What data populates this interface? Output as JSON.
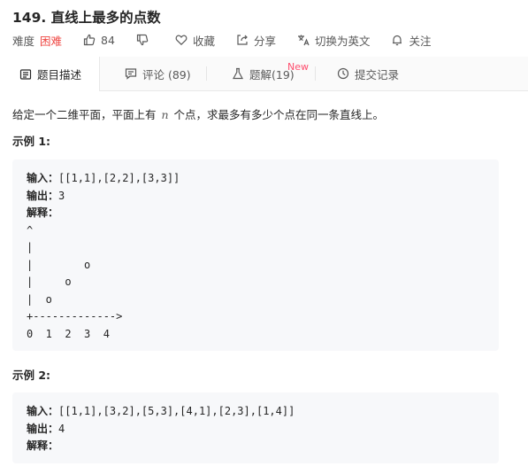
{
  "problem": {
    "title": "149. 直线上最多的点数",
    "difficulty_label": "难度",
    "difficulty": "困难",
    "likes": "84",
    "favorite_label": "收藏",
    "share_label": "分享",
    "translate_label": "切换为英文",
    "follow_label": "关注"
  },
  "tabs": [
    {
      "label": "题目描述"
    },
    {
      "label": "评论 (89)"
    },
    {
      "label": "题解(19)",
      "badge": "New"
    },
    {
      "label": "提交记录"
    }
  ],
  "content": {
    "desc_before": "给定一个二维平面，平面上有 ",
    "desc_var": "n",
    "desc_after": " 个点，求最多有多少个点在同一条直线上。",
    "example1_title": "示例 1:",
    "example1": {
      "input_label": "输入：",
      "input": "[[1,1],[2,2],[3,3]]",
      "output_label": "输出：",
      "output": "3",
      "explain_label": "解释：",
      "diagram": "^\n|\n|        o\n|     o\n|  o\n+------------->\n0  1  2  3  4"
    },
    "example2_title": "示例 2:",
    "example2": {
      "input_label": "输入：",
      "input": "[[1,1],[3,2],[5,3],[4,1],[2,3],[1,4]]",
      "output_label": "输出：",
      "output": "4",
      "explain_label": "解释："
    }
  },
  "colors": {
    "difficulty_hard": "#ef4743",
    "new_badge": "#ff4d6d",
    "code_bg": "#f7f8fa"
  }
}
